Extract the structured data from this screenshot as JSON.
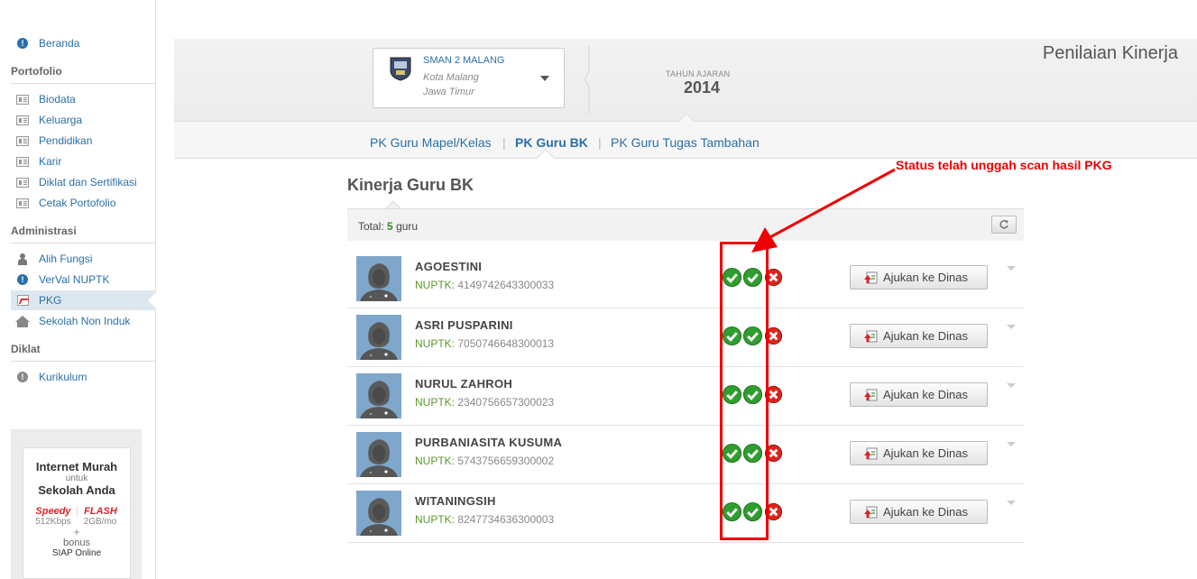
{
  "sidebar": {
    "home": "Beranda",
    "sections": {
      "portofolio": "Portofolio",
      "administrasi": "Administrasi",
      "diklat": "Diklat"
    },
    "portofolio_items": [
      "Biodata",
      "Keluarga",
      "Pendidikan",
      "Karir",
      "Diklat dan Sertifikasi",
      "Cetak Portofolio"
    ],
    "administrasi_items": [
      "Alih Fungsi",
      "VerVal NUPTK",
      "PKG",
      "Sekolah Non Induk"
    ],
    "diklat_items": [
      "Kurikulum"
    ],
    "active": "PKG"
  },
  "ad": {
    "line1": "Internet Murah",
    "line2": "untuk",
    "line3": "Sekolah Anda",
    "brand1": "Speedy",
    "brand2": "FLASH",
    "spec1": "512Kbps",
    "spec2": "2GB/mo",
    "plus": "+",
    "bonus": "bonus",
    "siap": "SIAP Online"
  },
  "header": {
    "school_name": "SMAN 2 MALANG",
    "school_city": "Kota Malang",
    "school_province": "Jawa Timur",
    "year_label": "TAHUN AJARAN",
    "year_value": "2014",
    "page_title": "Penilaian Kinerja"
  },
  "tabs": {
    "mapel": "PK Guru Mapel/Kelas",
    "bk": "PK Guru BK",
    "tambahan": "PK Guru Tugas Tambahan",
    "separator": "|",
    "active": "PK Guru BK"
  },
  "content": {
    "title": "Kinerja Guru BK",
    "total_prefix": "Total:",
    "total_count": "5",
    "total_suffix": "guru",
    "nuptk_label": "NUPTK:",
    "button_label": "Ajukan ke Dinas",
    "teachers": [
      {
        "name": "AGOESTINI",
        "nuptk": "4149742643300033"
      },
      {
        "name": "ASRI PUSPARINI",
        "nuptk": "7050746648300013"
      },
      {
        "name": "NURUL ZAHROH",
        "nuptk": "2340756657300023"
      },
      {
        "name": "PURBANIASITA KUSUMA",
        "nuptk": "5743756659300002"
      },
      {
        "name": "WITANINGSIH",
        "nuptk": "8247734636300003"
      }
    ]
  },
  "annotation": {
    "text": "Status telah unggah scan hasil PKG",
    "color": "#e00000"
  },
  "colors": {
    "link": "#2a6fa8",
    "nuptk_label": "#5a9a2a",
    "check": "#2f9e2f",
    "cross": "#d9251c"
  }
}
